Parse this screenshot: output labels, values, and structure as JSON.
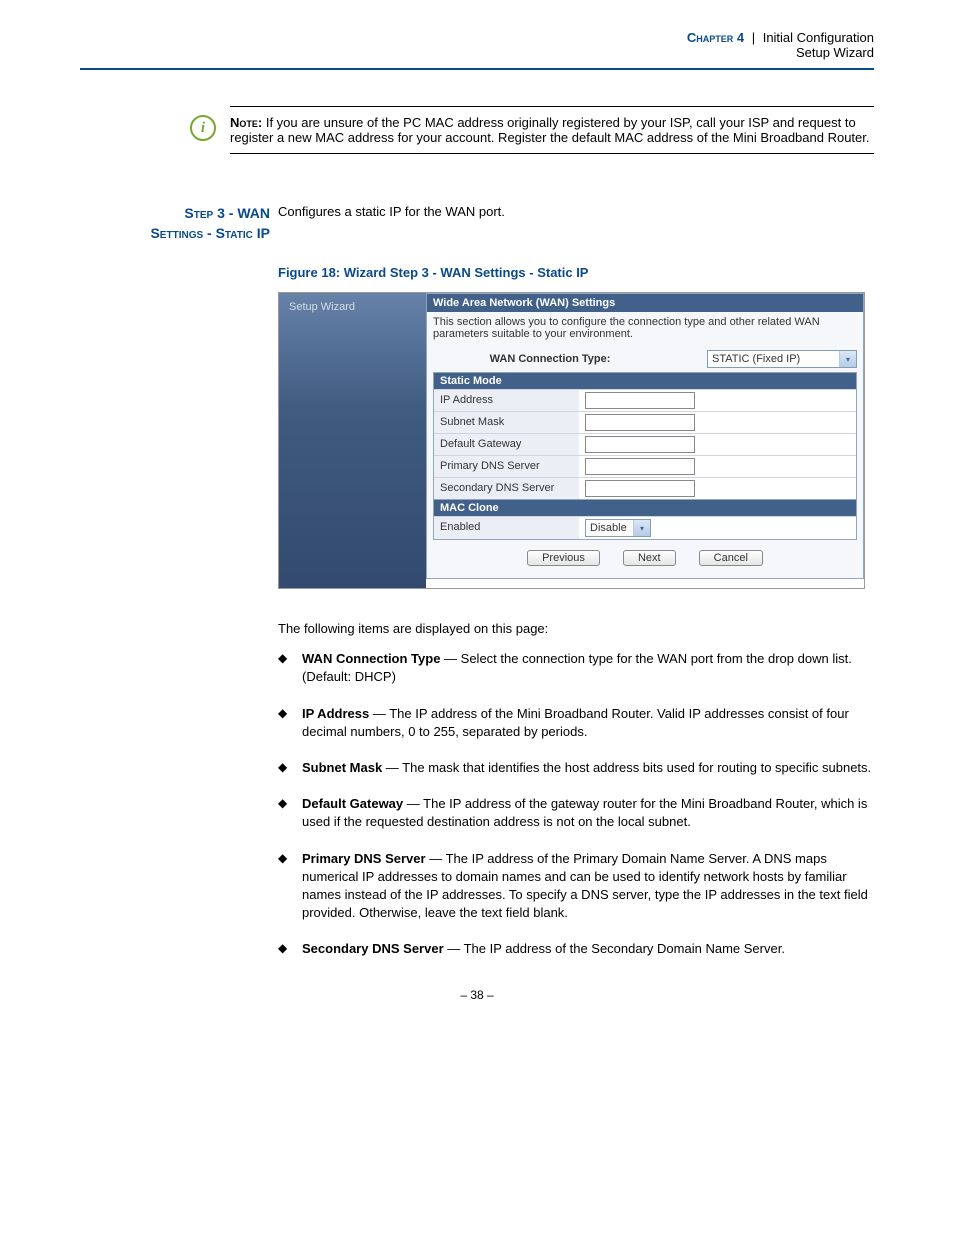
{
  "header": {
    "chapter_label": "Chapter 4",
    "section": "Initial Configuration",
    "subsection": "Setup Wizard"
  },
  "note": {
    "label": "Note:",
    "text": "If you are unsure of the PC MAC address originally registered by your ISP, call your ISP and request to register a new MAC address for your account. Register the default MAC address of the Mini Broadband Router."
  },
  "step": {
    "title_line1": "Step 3 - WAN",
    "title_line2": "Settings - Static IP",
    "desc": "Configures a static IP for the WAN port."
  },
  "figure_caption": "Figure 18:  Wizard Step 3 - WAN Settings - Static IP",
  "ui": {
    "sidebar_item": "Setup Wizard",
    "panel_title": "Wide Area Network (WAN) Settings",
    "panel_desc": "This section allows you to configure the connection type and other related WAN parameters suitable to your environment.",
    "conn_label": "WAN Connection Type:",
    "conn_value": "STATIC (Fixed IP)",
    "section_static": "Static Mode",
    "rows": {
      "ip": "IP Address",
      "mask": "Subnet Mask",
      "gateway": "Default Gateway",
      "dns1": "Primary DNS Server",
      "dns2": "Secondary DNS Server"
    },
    "section_mac": "MAC Clone",
    "mac_enabled_label": "Enabled",
    "mac_enabled_value": "Disable",
    "buttons": {
      "prev": "Previous",
      "next": "Next",
      "cancel": "Cancel"
    }
  },
  "intro": "The following items are displayed on this page:",
  "items": [
    {
      "title": "WAN Connection Type",
      "text": " — Select the connection type for the WAN port from the drop down list. (Default: DHCP)"
    },
    {
      "title": "IP Address",
      "text": " — The IP address of the Mini Broadband Router. Valid IP addresses consist of four decimal numbers, 0 to 255, separated by periods."
    },
    {
      "title": "Subnet Mask",
      "text": " — The mask that identifies the host address bits used for routing to specific subnets."
    },
    {
      "title": "Default Gateway",
      "text": " — The IP address of the gateway router for the Mini Broadband Router, which is used if the requested destination address is not on the local subnet."
    },
    {
      "title": "Primary DNS Server",
      "text": " — The IP address of the Primary Domain Name Server. A DNS maps numerical IP addresses to domain names and can be used to identify network hosts by familiar names instead of the IP addresses. To specify a DNS server, type the IP addresses in the text field provided. Otherwise, leave the text field blank."
    },
    {
      "title": "Secondary DNS Server",
      "text": " — The IP address of the Secondary Domain Name Server."
    }
  ],
  "page_number": "–  38  –"
}
